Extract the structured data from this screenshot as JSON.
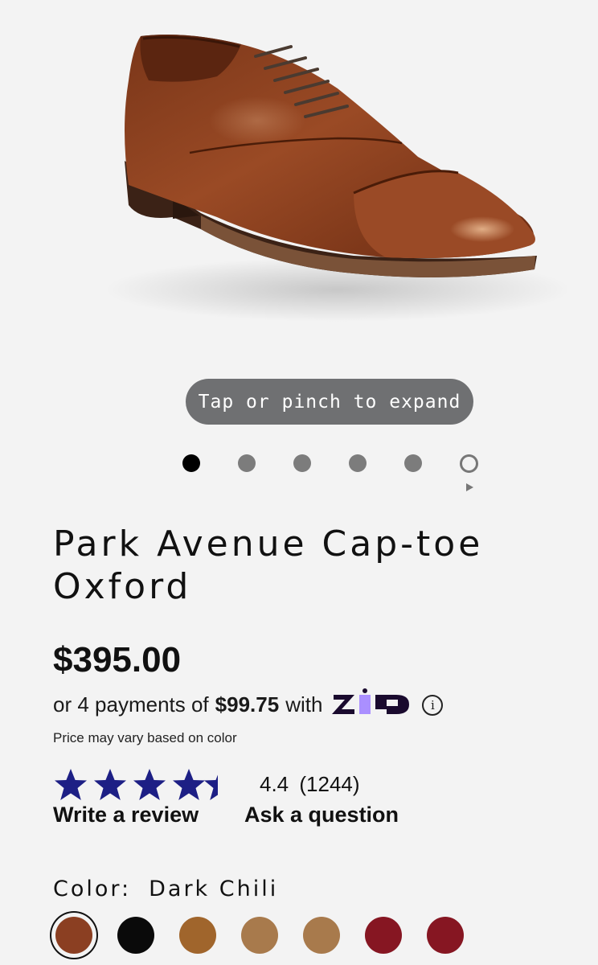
{
  "gallery": {
    "hint": "Tap or pinch to expand",
    "image_alt": "shoe-photo",
    "dots": [
      "active",
      "inactive",
      "inactive",
      "inactive",
      "inactive",
      "ring"
    ]
  },
  "product": {
    "title": "Park Avenue Cap-toe Oxford",
    "price": "$395.00",
    "payments_prefix": "or 4 payments of",
    "payments_amount": "$99.75",
    "payments_suffix": "with",
    "zip_logo": "ZIP",
    "info": "i",
    "price_note": "Price may vary based on color"
  },
  "reviews": {
    "rating": "4.4",
    "count": "(1244)",
    "stars_value": 4.4,
    "write_review": "Write a review",
    "ask_question": "Ask a question"
  },
  "color": {
    "label": "Color:",
    "value": "Dark Chili",
    "swatches": [
      "#8b3f22",
      "#0a0a0a",
      "#a0652c",
      "#a87a4c",
      "#a87a4c",
      "#861622",
      "#861622"
    ]
  },
  "colors": {
    "star": "#1d1f85",
    "pill_bg": "#6f7072",
    "background": "#f3f3f3"
  }
}
